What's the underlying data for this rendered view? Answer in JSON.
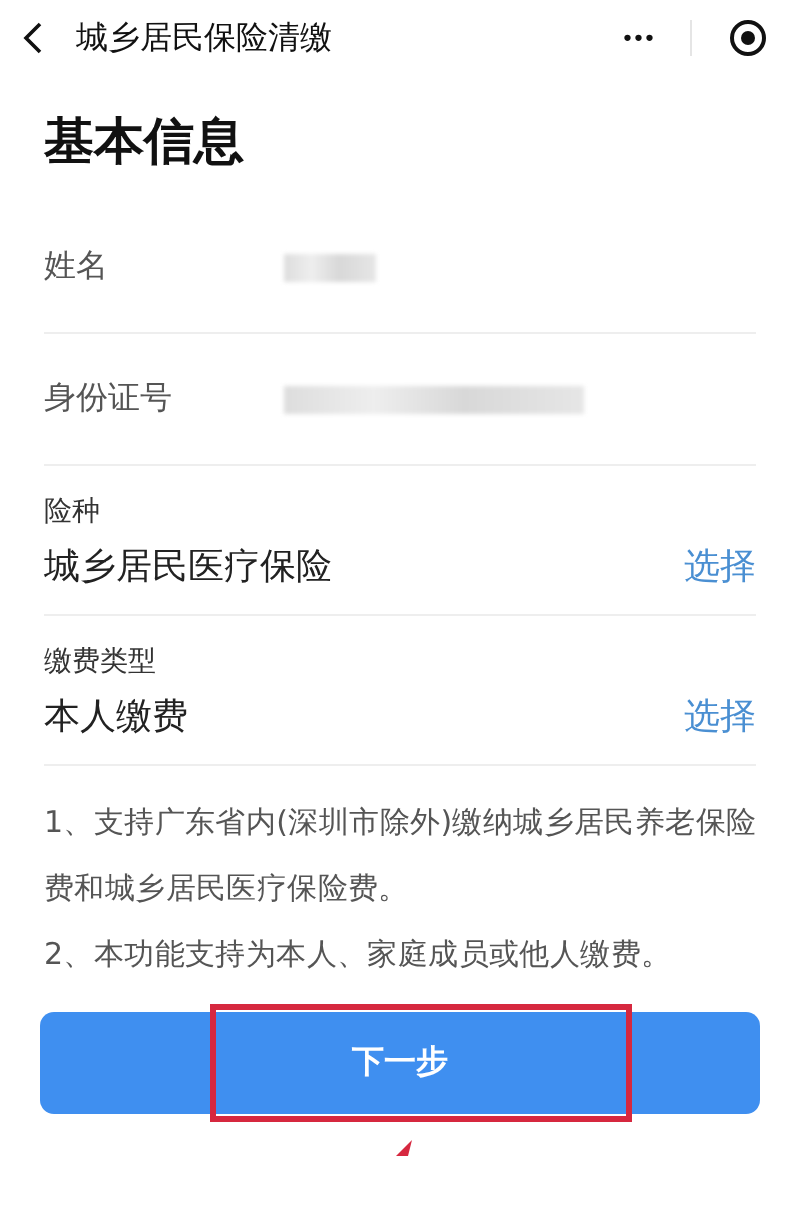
{
  "nav": {
    "title": "城乡居民保险清缴",
    "more": "•••"
  },
  "heading": "基本信息",
  "fields": [
    {
      "kind": "static",
      "label": "姓名",
      "blurred": true
    },
    {
      "kind": "static",
      "label": "身份证号",
      "blurred": true
    },
    {
      "kind": "select",
      "label": "险种",
      "value": "城乡居民医疗保险",
      "action": "选择"
    },
    {
      "kind": "select",
      "label": "缴费类型",
      "value": "本人缴费",
      "action": "选择"
    }
  ],
  "notes": [
    "1、支持广东省内(深圳市除外)缴纳城乡居民养老保险费和城乡居民医疗保险费。",
    "2、本功能支持为本人、家庭成员或他人缴费。"
  ],
  "button": {
    "label": "下一步",
    "highlighted": true
  }
}
